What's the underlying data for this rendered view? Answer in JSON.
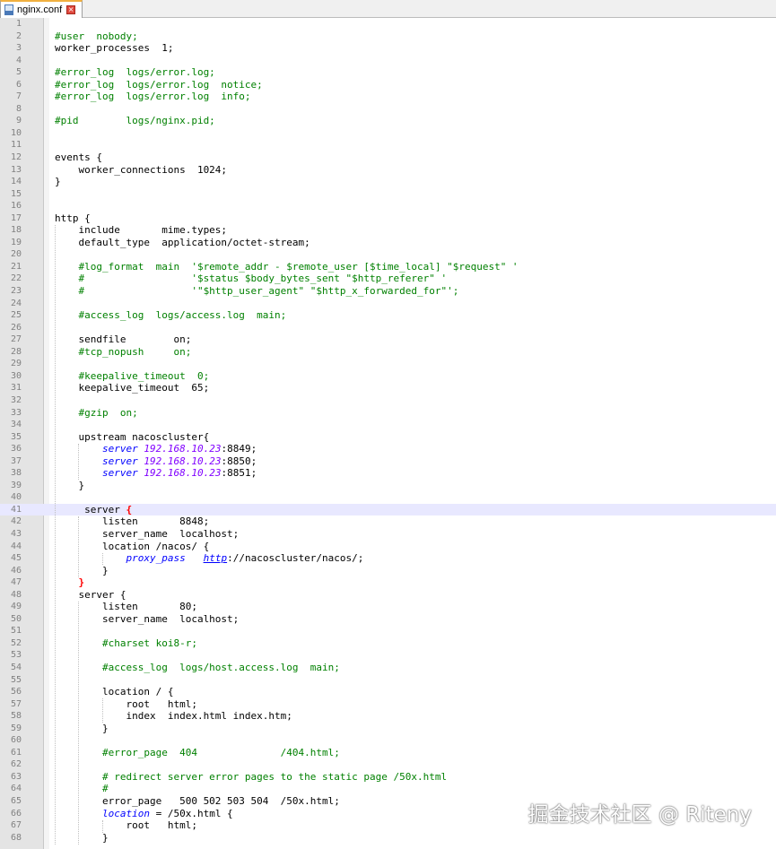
{
  "tab": {
    "title": "nginx.conf",
    "icon": "file-icon",
    "close_icon": "close-icon",
    "close_color": "#e04a3f"
  },
  "colors": {
    "comment": "#008000",
    "keyword": "#0000ff",
    "number": "#8000ff",
    "brace_match": "#ff0000",
    "current_line": "#e8e8ff"
  },
  "current_line": 41,
  "lines": [
    {
      "n": "1",
      "segs": []
    },
    {
      "n": "2",
      "segs": [
        {
          "t": "#user  nobody;",
          "s": "c"
        }
      ]
    },
    {
      "n": "3",
      "segs": [
        {
          "t": "worker_processes  1;"
        }
      ]
    },
    {
      "n": "4",
      "segs": []
    },
    {
      "n": "5",
      "segs": [
        {
          "t": "#error_log  logs/error.log;",
          "s": "c"
        }
      ]
    },
    {
      "n": "6",
      "segs": [
        {
          "t": "#error_log  logs/error.log  notice;",
          "s": "c"
        }
      ]
    },
    {
      "n": "7",
      "segs": [
        {
          "t": "#error_log  logs/error.log  info;",
          "s": "c"
        }
      ]
    },
    {
      "n": "8",
      "segs": []
    },
    {
      "n": "9",
      "segs": [
        {
          "t": "#pid        logs/nginx.pid;",
          "s": "c"
        }
      ]
    },
    {
      "n": "10",
      "segs": []
    },
    {
      "n": "11",
      "segs": []
    },
    {
      "n": "12",
      "segs": [
        {
          "t": "events {"
        }
      ]
    },
    {
      "n": "13",
      "segs": [
        {
          "t": "    worker_connections  1024;"
        }
      ]
    },
    {
      "n": "14",
      "segs": [
        {
          "t": "}"
        }
      ]
    },
    {
      "n": "15",
      "segs": []
    },
    {
      "n": "16",
      "segs": []
    },
    {
      "n": "17",
      "segs": [
        {
          "t": "http {"
        }
      ]
    },
    {
      "n": "18",
      "segs": [
        {
          "t": "    include       mime.types;"
        }
      ]
    },
    {
      "n": "19",
      "segs": [
        {
          "t": "    default_type  application/octet-stream;"
        }
      ]
    },
    {
      "n": "20",
      "segs": []
    },
    {
      "n": "21",
      "segs": [
        {
          "t": "    #log_format  main  '$remote_addr - $remote_user [$time_local] \"$request\" '",
          "s": "c"
        }
      ]
    },
    {
      "n": "22",
      "segs": [
        {
          "t": "    #                  '$status $body_bytes_sent \"$http_referer\" '",
          "s": "c"
        }
      ]
    },
    {
      "n": "23",
      "segs": [
        {
          "t": "    #                  '\"$http_user_agent\" \"$http_x_forwarded_for\"';",
          "s": "c"
        }
      ]
    },
    {
      "n": "24",
      "segs": []
    },
    {
      "n": "25",
      "segs": [
        {
          "t": "    #access_log  logs/access.log  main;",
          "s": "c"
        }
      ]
    },
    {
      "n": "26",
      "segs": []
    },
    {
      "n": "27",
      "segs": [
        {
          "t": "    sendfile        on;"
        }
      ]
    },
    {
      "n": "28",
      "segs": [
        {
          "t": "    #tcp_nopush     on;",
          "s": "c"
        }
      ]
    },
    {
      "n": "29",
      "segs": []
    },
    {
      "n": "30",
      "segs": [
        {
          "t": "    #keepalive_timeout  0;",
          "s": "c"
        }
      ]
    },
    {
      "n": "31",
      "segs": [
        {
          "t": "    keepalive_timeout  65;"
        }
      ]
    },
    {
      "n": "32",
      "segs": []
    },
    {
      "n": "33",
      "segs": [
        {
          "t": "    #gzip  on;",
          "s": "c"
        }
      ]
    },
    {
      "n": "34",
      "segs": []
    },
    {
      "n": "35",
      "segs": [
        {
          "t": "    upstream nacoscluster{"
        }
      ]
    },
    {
      "n": "36",
      "segs": [
        {
          "t": "        "
        },
        {
          "t": "server",
          "s": "k"
        },
        {
          "t": " "
        },
        {
          "t": "192.168.10.23",
          "s": "n"
        },
        {
          "t": ":8849;"
        }
      ]
    },
    {
      "n": "37",
      "segs": [
        {
          "t": "        "
        },
        {
          "t": "server",
          "s": "k"
        },
        {
          "t": " "
        },
        {
          "t": "192.168.10.23",
          "s": "n"
        },
        {
          "t": ":8850;"
        }
      ]
    },
    {
      "n": "38",
      "segs": [
        {
          "t": "        "
        },
        {
          "t": "server",
          "s": "k"
        },
        {
          "t": " "
        },
        {
          "t": "192.168.10.23",
          "s": "n"
        },
        {
          "t": ":8851;"
        }
      ]
    },
    {
      "n": "39",
      "segs": [
        {
          "t": "    }"
        }
      ]
    },
    {
      "n": "40",
      "segs": []
    },
    {
      "n": "41",
      "segs": [
        {
          "t": "     server "
        },
        {
          "t": "{",
          "s": "b"
        }
      ]
    },
    {
      "n": "42",
      "segs": [
        {
          "t": "        listen       8848;"
        }
      ]
    },
    {
      "n": "43",
      "segs": [
        {
          "t": "        server_name  localhost;"
        }
      ]
    },
    {
      "n": "44",
      "segs": [
        {
          "t": "        location /nacos/ {"
        }
      ]
    },
    {
      "n": "45",
      "segs": [
        {
          "t": "            "
        },
        {
          "t": "proxy_pass",
          "s": "k"
        },
        {
          "t": "   "
        },
        {
          "t": "http",
          "s": "u"
        },
        {
          "t": "://nacoscluster/nacos/;"
        }
      ]
    },
    {
      "n": "46",
      "segs": [
        {
          "t": "        }"
        }
      ]
    },
    {
      "n": "47",
      "segs": [
        {
          "t": "    "
        },
        {
          "t": "}",
          "s": "b"
        }
      ]
    },
    {
      "n": "48",
      "segs": [
        {
          "t": "    server {"
        }
      ]
    },
    {
      "n": "49",
      "segs": [
        {
          "t": "        listen       80;"
        }
      ]
    },
    {
      "n": "50",
      "segs": [
        {
          "t": "        server_name  localhost;"
        }
      ]
    },
    {
      "n": "51",
      "segs": []
    },
    {
      "n": "52",
      "segs": [
        {
          "t": "        #charset koi8-r;",
          "s": "c"
        }
      ]
    },
    {
      "n": "53",
      "segs": []
    },
    {
      "n": "54",
      "segs": [
        {
          "t": "        #access_log  logs/host.access.log  main;",
          "s": "c"
        }
      ]
    },
    {
      "n": "55",
      "segs": []
    },
    {
      "n": "56",
      "segs": [
        {
          "t": "        location / {"
        }
      ]
    },
    {
      "n": "57",
      "segs": [
        {
          "t": "            root   html;"
        }
      ]
    },
    {
      "n": "58",
      "segs": [
        {
          "t": "            index  index.html index.htm;"
        }
      ]
    },
    {
      "n": "59",
      "segs": [
        {
          "t": "        }"
        }
      ]
    },
    {
      "n": "60",
      "segs": []
    },
    {
      "n": "61",
      "segs": [
        {
          "t": "        #error_page  404              /404.html;",
          "s": "c"
        }
      ]
    },
    {
      "n": "62",
      "segs": []
    },
    {
      "n": "63",
      "segs": [
        {
          "t": "        # redirect server error pages to the static page /50x.html",
          "s": "c"
        }
      ]
    },
    {
      "n": "64",
      "segs": [
        {
          "t": "        #",
          "s": "c"
        }
      ]
    },
    {
      "n": "65",
      "segs": [
        {
          "t": "        error_page   500 502 503 504  /50x.html;"
        }
      ]
    },
    {
      "n": "66",
      "segs": [
        {
          "t": "        "
        },
        {
          "t": "location",
          "s": "k"
        },
        {
          "t": " = /50x.html {"
        }
      ]
    },
    {
      "n": "67",
      "segs": [
        {
          "t": "            root   html;"
        }
      ]
    },
    {
      "n": "68",
      "segs": [
        {
          "t": "        }"
        }
      ]
    }
  ],
  "watermark": "掘金技术社区 @ Riteny"
}
